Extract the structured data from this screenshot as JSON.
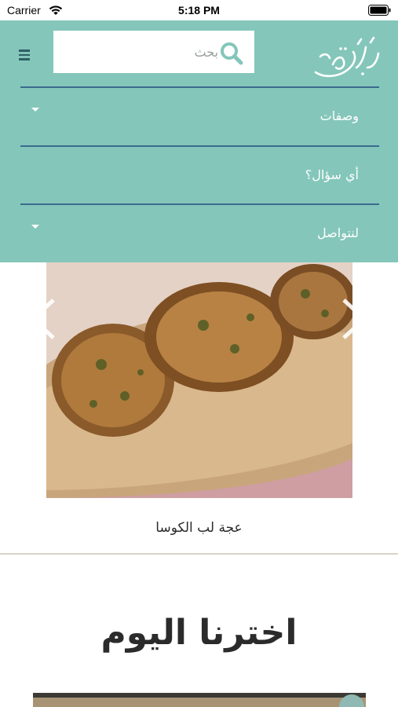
{
  "status_bar": {
    "carrier": "Carrier",
    "time": "5:18 PM"
  },
  "header": {
    "logo_text": "أطيب أكلة",
    "search": {
      "placeholder": "بحث",
      "value": ""
    },
    "menu_icon": "hamburger-icon",
    "search_icon": "search-icon"
  },
  "menu": {
    "items": [
      {
        "label": "وصفات",
        "has_dropdown": true
      },
      {
        "label": "أي سؤال؟",
        "has_dropdown": false
      },
      {
        "label": "لنتواصل",
        "has_dropdown": true
      }
    ]
  },
  "slider": {
    "caption": "عجة لب الكوسا"
  },
  "section": {
    "title": "اخترنا اليوم"
  },
  "colors": {
    "header_bg": "#84c6ba",
    "divider": "#3b6a8e",
    "icon_dark": "#2f5f66",
    "text_white": "#ffffff"
  }
}
